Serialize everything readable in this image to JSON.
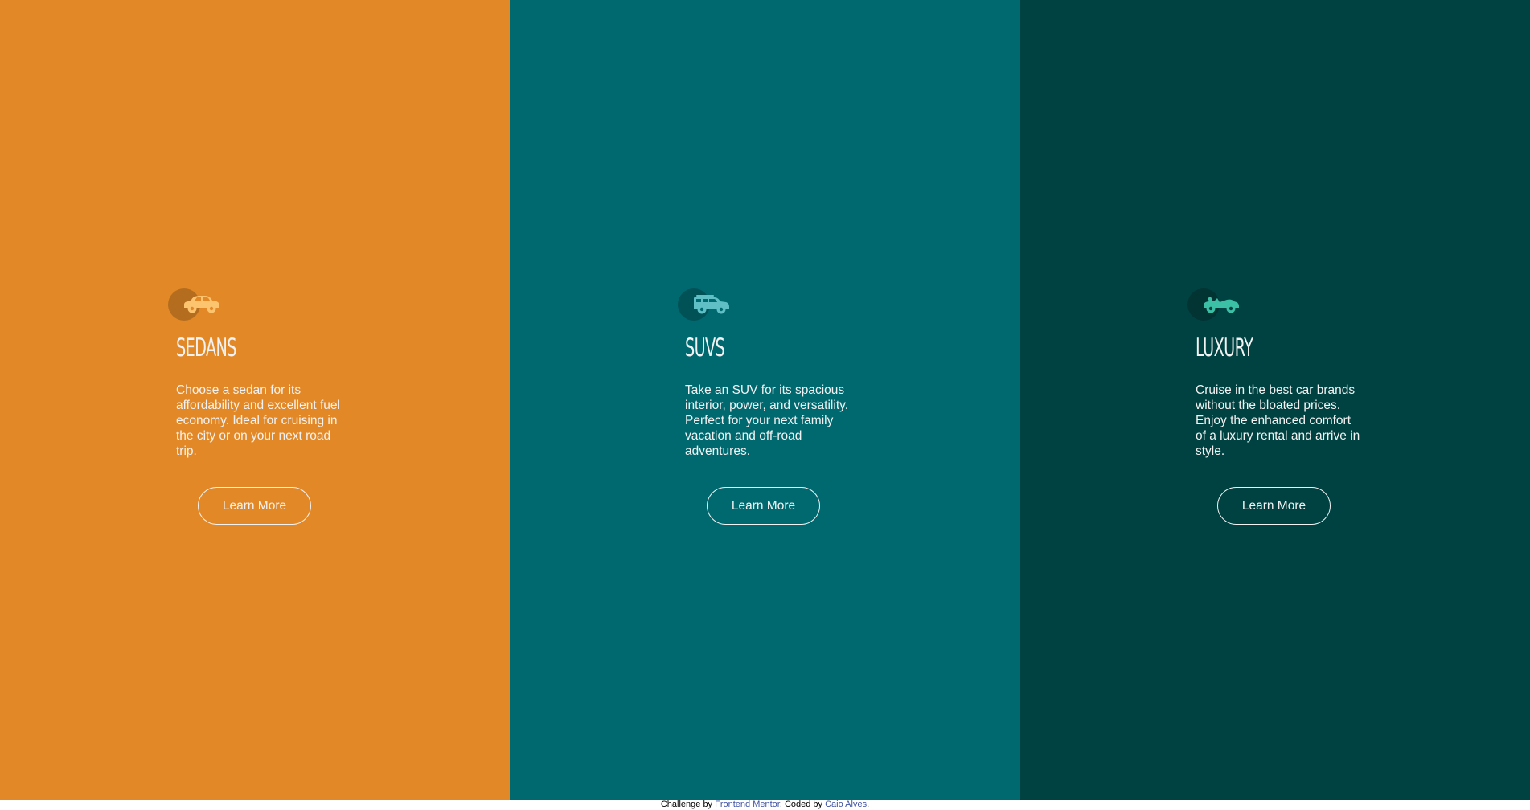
{
  "colors": {
    "sedans_bg": "#e38826",
    "suvs_bg": "#006970",
    "luxury_bg": "#004241",
    "text_light": "#f2f2f2",
    "link": "#3e52a3"
  },
  "cards": [
    {
      "icon": "sedan-car-icon",
      "title": "Sedans",
      "description": "Choose a sedan for its affordability and excellent fuel economy. Ideal for cruising in the city or on your next road trip.",
      "button_label": "Learn More"
    },
    {
      "icon": "suv-car-icon",
      "title": "SUVs",
      "description": "Take an SUV for its spacious interior, power, and versatility. Perfect for your next family vacation and off-road adventures.",
      "button_label": "Learn More"
    },
    {
      "icon": "luxury-car-icon",
      "title": "Luxury",
      "description": "Cruise in the best car brands without the bloated prices. Enjoy the enhanced comfort of a luxury rental and arrive in style.",
      "button_label": "Learn More"
    }
  ],
  "footer": {
    "prefix": "Challenge by ",
    "challenge_link": "Frontend Mentor",
    "middle": ". Coded by ",
    "author_link": "Caio Alves",
    "suffix": "."
  }
}
